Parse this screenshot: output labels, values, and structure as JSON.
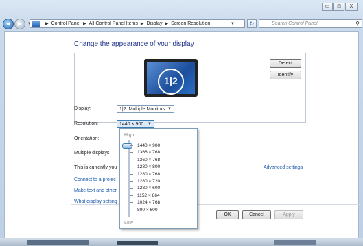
{
  "window": {
    "caption_buttons": [
      "▭",
      "⊡",
      "X"
    ]
  },
  "address_bar": {
    "crumbs": [
      "Control Panel",
      "All Control Panel Items",
      "Display",
      "Screen Resolution"
    ],
    "search_placeholder": "Search Control Panel"
  },
  "main": {
    "title": "Change the appearance of your display",
    "detect_label": "Detect",
    "identify_label": "Identify",
    "monitor_label": "1|2",
    "display_label": "Display:",
    "display_value": "1|2. Multiple Monitors",
    "resolution_label": "Resolution:",
    "resolution_value": "1440 × 900",
    "orientation_label": "Orientation:",
    "multiple_displays_label": "Multiple displays:",
    "currently_text": "This is currently you",
    "advanced_link": "Advanced settings",
    "link_project": "Connect to a projec",
    "link_text": "Make text and other",
    "link_display": "What display setting",
    "ok_label": "OK",
    "cancel_label": "Cancel",
    "apply_label": "Apply"
  },
  "resolution_dropdown": {
    "high_label": "High",
    "low_label": "Low",
    "options": [
      "1440 × 900",
      "1366 × 768",
      "1360 × 768",
      "1280 × 800",
      "1280 × 768",
      "1280 × 720",
      "1280 × 600",
      "1152 × 864",
      "1024 × 768",
      "800 × 600"
    ],
    "selected": "1440 × 900"
  }
}
